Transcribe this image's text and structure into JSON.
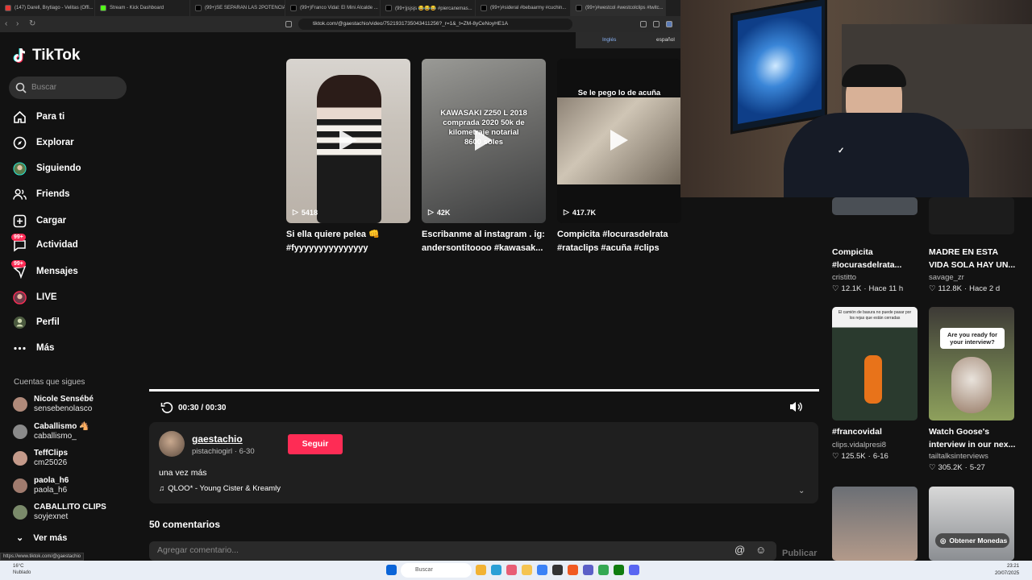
{
  "browser": {
    "tabs": [
      {
        "title": "(147) Darell, Brytiago - Velitas (Offi...",
        "color": "#e53935"
      },
      {
        "title": "Stream - Kick Dashboard",
        "color": "#53fc18"
      },
      {
        "title": "(99+)SE SEPARAN LAS 2POTENCIA...",
        "color": "#000000"
      },
      {
        "title": "(99+)Franco Vidal: El Mini Alcalde ...",
        "color": "#000000"
      },
      {
        "title": "(99+)jsjsjs 😂😂😂 #piercanemas...",
        "color": "#000000"
      },
      {
        "title": "(99+)#sideral #bebaarmy #cuchin...",
        "color": "#000000"
      },
      {
        "title": "(99+)#westcol #westcolclips #twitc...",
        "color": "#000000"
      }
    ],
    "url": "tiktok.com/@gaestachio/video/7521931735043411256?_r=1&_t=ZM-8yCeNoyHE1A",
    "translate": {
      "from": "Inglés",
      "to": "español"
    }
  },
  "sidebar": {
    "logo": "TikTok",
    "search_placeholder": "Buscar",
    "nav": [
      {
        "label": "Para ti",
        "icon": "home-icon"
      },
      {
        "label": "Explorar",
        "icon": "compass-icon"
      },
      {
        "label": "Siguiendo",
        "icon": "following-avatar-icon"
      },
      {
        "label": "Friends",
        "icon": "friends-icon"
      },
      {
        "label": "Cargar",
        "icon": "upload-icon"
      },
      {
        "label": "Actividad",
        "icon": "activity-icon",
        "badge": "99+"
      },
      {
        "label": "Mensajes",
        "icon": "messages-icon",
        "badge": "99+"
      },
      {
        "label": "LIVE",
        "icon": "live-icon"
      },
      {
        "label": "Perfil",
        "icon": "profile-icon"
      },
      {
        "label": "Más",
        "icon": "more-icon"
      }
    ],
    "following_heading": "Cuentas que sigues",
    "following": [
      {
        "name": "Nicole Sensébé",
        "handle": "sensebenolasco"
      },
      {
        "name": "Caballismo 🐴",
        "handle": "caballismo_"
      },
      {
        "name": "TeffClips",
        "handle": "cm25026"
      },
      {
        "name": "paola_h6",
        "handle": "paola_h6"
      },
      {
        "name": "CABALLITO CLIPS",
        "handle": "soyjexnet"
      }
    ],
    "see_more": "Ver más"
  },
  "suggested": [
    {
      "title": "Si ella quiere pelea 👊 #fyyyyyyyyyyyyyyy",
      "views": "5418",
      "overlay": ""
    },
    {
      "title": "Escribanme al instagram . ig: andersontitoooo #kawasak...",
      "views": "42K",
      "overlay": "KAWASAKI Z250 L 2018 comprada 2020 50k de kilometraje notarial 8600 soles"
    },
    {
      "title": "Compicita #locurasdelrata #rataclips #acuña #clips",
      "views": "417.7K",
      "overlay": "Se le pego lo de acuña"
    }
  ],
  "player": {
    "time": "00:30 / 00:30",
    "progress_fraction": 1.0
  },
  "author": {
    "username": "gaestachio",
    "subtitle": "pistachiogirl · 6-30",
    "follow_label": "Seguir",
    "caption": "una vez más",
    "music": "QLOO* - Young Cister & Kreamly"
  },
  "comments": {
    "heading": "50 comentarios",
    "placeholder": "Agregar comentario...",
    "publish": "Publicar"
  },
  "related": [
    {
      "title": "Compicita #locurasdelrata...",
      "author": "cristitto",
      "likes": "12.1K",
      "time": "Hace 11 h"
    },
    {
      "title": "MADRE EN ESTA VIDA SOLA HAY UN...",
      "author": "savage_zr",
      "likes": "112.8K",
      "time": "Hace 2 d"
    },
    {
      "title": "#francovidal",
      "author": "clips.vidalpresi8",
      "likes": "125.5K",
      "time": "6-16",
      "thumb_text": "El camión de basura no puede pasar por los rejas que están cerradas"
    },
    {
      "title": "Watch Goose's interview in our nex...",
      "author": "tailtalksinterviews",
      "likes": "305.2K",
      "time": "5-27",
      "thumb_text": "Are you ready for your interview?"
    }
  ],
  "coins_button": "Obtener Monedas",
  "status_link": "https://www.tiktok.com/@gaestachio",
  "taskbar": {
    "weather_temp": "16°C",
    "weather_desc": "Nublado",
    "search": "Buscar",
    "time": "23:21",
    "date": "20/07/2025"
  },
  "colors": {
    "accent": "#fe2c55",
    "background": "#121212"
  }
}
